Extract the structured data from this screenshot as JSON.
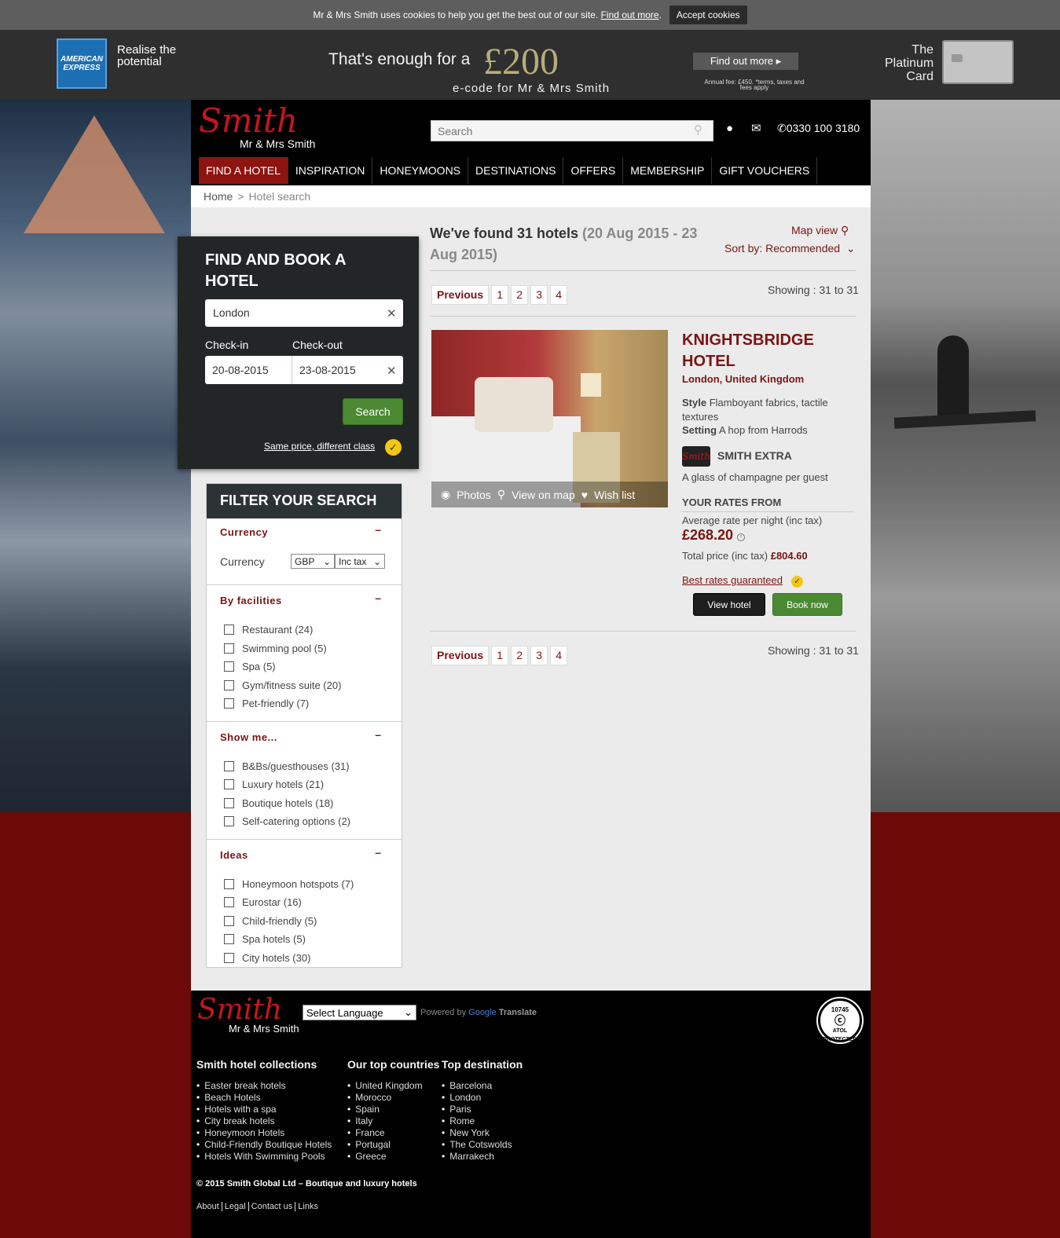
{
  "cookie": {
    "text": "Mr & Mrs Smith uses cookies to help you get the best out of our site.",
    "link": "Find out more",
    "period": ".",
    "accept": "Accept cookies"
  },
  "amex": {
    "logo": "AMERICAN EXPRESS",
    "slogan": "Realise the potential",
    "headline": "That's enough for a",
    "amount": "£200",
    "sub": "e-code for Mr & Mrs Smith",
    "cta": "Find out more ▸",
    "fee": "Annual fee: £450. *terms, taxes and fees apply",
    "card_label": "The Platinum Card"
  },
  "header": {
    "logo_script": "Smith",
    "logo_name": "Mr & Mrs Smith",
    "search_placeholder": "Search",
    "phone": "0330 100 3180",
    "nav": [
      "FIND A HOTEL",
      "INSPIRATION",
      "HONEYMOONS",
      "DESTINATIONS",
      "OFFERS",
      "MEMBERSHIP",
      "GIFT VOUCHERS"
    ]
  },
  "breadcrumb": {
    "home": "Home",
    "sep": ">",
    "current": "Hotel search"
  },
  "book": {
    "title": "FIND AND BOOK A HOTEL",
    "city": "London",
    "checkin_label": "Check-in",
    "checkout_label": "Check-out",
    "checkin": "20-08-2015",
    "checkout": "23-08-2015",
    "search": "Search",
    "same_price": "Same price, different class"
  },
  "filter": {
    "title": "FILTER YOUR SEARCH",
    "currency_title": "Currency",
    "currency_label": "Currency",
    "currency_value": "GBP",
    "tax_value": "Inc tax",
    "facilities_title": "By facilities",
    "facilities": [
      "Restaurant (24)",
      "Swimming pool (5)",
      "Spa (5)",
      "Gym/fitness suite (20)",
      "Pet-friendly (7)"
    ],
    "show_title": "Show me...",
    "show": [
      "B&Bs/guesthouses (31)",
      "Luxury hotels (21)",
      "Boutique hotels (18)",
      "Self-catering options (2)"
    ],
    "ideas_title": "Ideas",
    "ideas": [
      "Honeymoon hotspots (7)",
      "Eurostar (16)",
      "Child-friendly (5)",
      "Spa hotels (5)",
      "City hotels (30)"
    ]
  },
  "results": {
    "found": "We've found 31 hotels",
    "dates": "(20 Aug 2015 - 23 Aug 2015)",
    "map_view": "Map view",
    "sort": "Sort by: Recommended",
    "previous": "Previous",
    "pages": [
      "1",
      "2",
      "3",
      "4"
    ],
    "showing": "Showing : 31 to 31",
    "hotel": {
      "name": "KNIGHTSBRIDGE HOTEL",
      "location": "London, United Kingdom",
      "style_label": "Style",
      "style": "Flamboyant fabrics, tactile textures",
      "setting_label": "Setting",
      "setting": "A hop from Harrods",
      "extra_logo": "Smith",
      "extra": "SMITH EXTRA",
      "extra_desc": "A glass of champagne per guest",
      "rates_title": "YOUR RATES FROM",
      "avg_label": "Average rate per night (inc tax)",
      "price": "£268.20",
      "total_label": "Total price (inc tax)",
      "total": "£804.60",
      "best_rates": "Best rates guaranteed",
      "photos": "Photos",
      "view_map": "View on map",
      "wish": "Wish list",
      "view_btn": "View hotel",
      "book_btn": "Book now"
    }
  },
  "footer": {
    "logo_script": "Smith",
    "logo_name": "Mr & Mrs Smith",
    "language": "Select Language",
    "powered_by": "Powered by",
    "google": "Google",
    "translate": "Translate",
    "atol_number": "10745",
    "atol_text": "ATOL PROTECTED",
    "col1_title": "Smith hotel collections",
    "col1": [
      "Easter break hotels",
      "Beach Hotels",
      "Hotels with a spa",
      "City break hotels",
      "Honeymoon Hotels",
      "Child-Friendly Boutique Hotels",
      "Hotels With Swimming Pools"
    ],
    "col2_title": "Our top countries",
    "col2": [
      "United Kingdom",
      "Morocco",
      "Spain",
      "Italy",
      "France",
      "Portugal",
      "Greece"
    ],
    "col3_title": "Top destination",
    "col3": [
      "Barcelona",
      "London",
      "Paris",
      "Rome",
      "New York",
      "The Cotswolds",
      "Marrakech"
    ],
    "copyright": "© 2015 Smith Global Ltd – Boutique and luxury hotels",
    "links": [
      "About",
      "Legal",
      "Contact us",
      "Links"
    ]
  },
  "colors": {
    "brand_red": "#7b1414",
    "nav_active": "#8e1410",
    "green": "#4b8a32",
    "page_red": "#6b0a07"
  }
}
